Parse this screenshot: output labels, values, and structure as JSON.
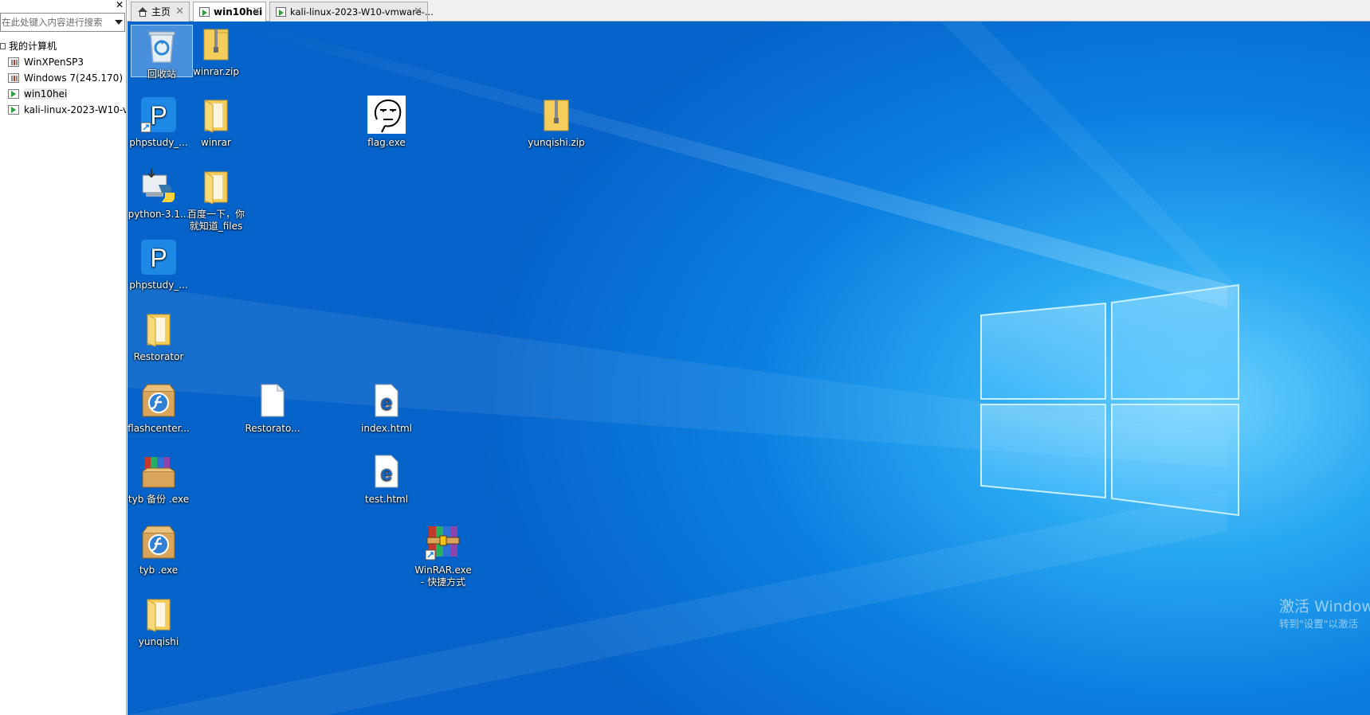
{
  "sidebar": {
    "close_label": "✕",
    "search_placeholder": "在此处键入内容进行搜索",
    "root_label": "我的计算机",
    "items": [
      {
        "label": "WinXPenSP3",
        "state": "off"
      },
      {
        "label": "Windows 7(245.170)",
        "state": "off"
      },
      {
        "label": "win10hei",
        "state": "on"
      },
      {
        "label": "kali-linux-2023-W10-vmware",
        "state": "on"
      }
    ]
  },
  "tabs": [
    {
      "label": "主页",
      "close": "✕"
    },
    {
      "label": "win10hei",
      "close": "✕"
    },
    {
      "label": "kali-linux-2023-W10-vmware-...",
      "close": "✕"
    }
  ],
  "desktop": {
    "icons": {
      "recycle_bin": "回收站",
      "winrar_zip": "winrar.zip",
      "phpstudy_1": "phpstudy_...",
      "winrar_folder": "winrar",
      "flag_exe": "flag.exe",
      "yunqishi_zip": "yunqishi.zip",
      "python": "python-3.1...",
      "baidu_files": "百度一下，你就知道_files",
      "phpstudy_2": "phpstudy_...",
      "restorator_folder": "Restorator",
      "flashcenter": "flashcenter...",
      "restorato_file": "Restorato...",
      "index_html": "index.html",
      "tyb_backup": "tyb 备份 .exe",
      "test_html": "test.html",
      "tyb_exe": "tyb .exe",
      "winrar_shortcut": "WinRAR.exe - 快捷方式",
      "yunqishi_folder": "yunqishi"
    },
    "watermark": {
      "line1": "激活 Window",
      "line2": "转到\"设置\"以激活"
    }
  },
  "colors": {
    "desktop_blue": "#0b7fe0",
    "folder_yellow": "#f4cd5c",
    "phpstudy_blue": "#1e88e5"
  }
}
